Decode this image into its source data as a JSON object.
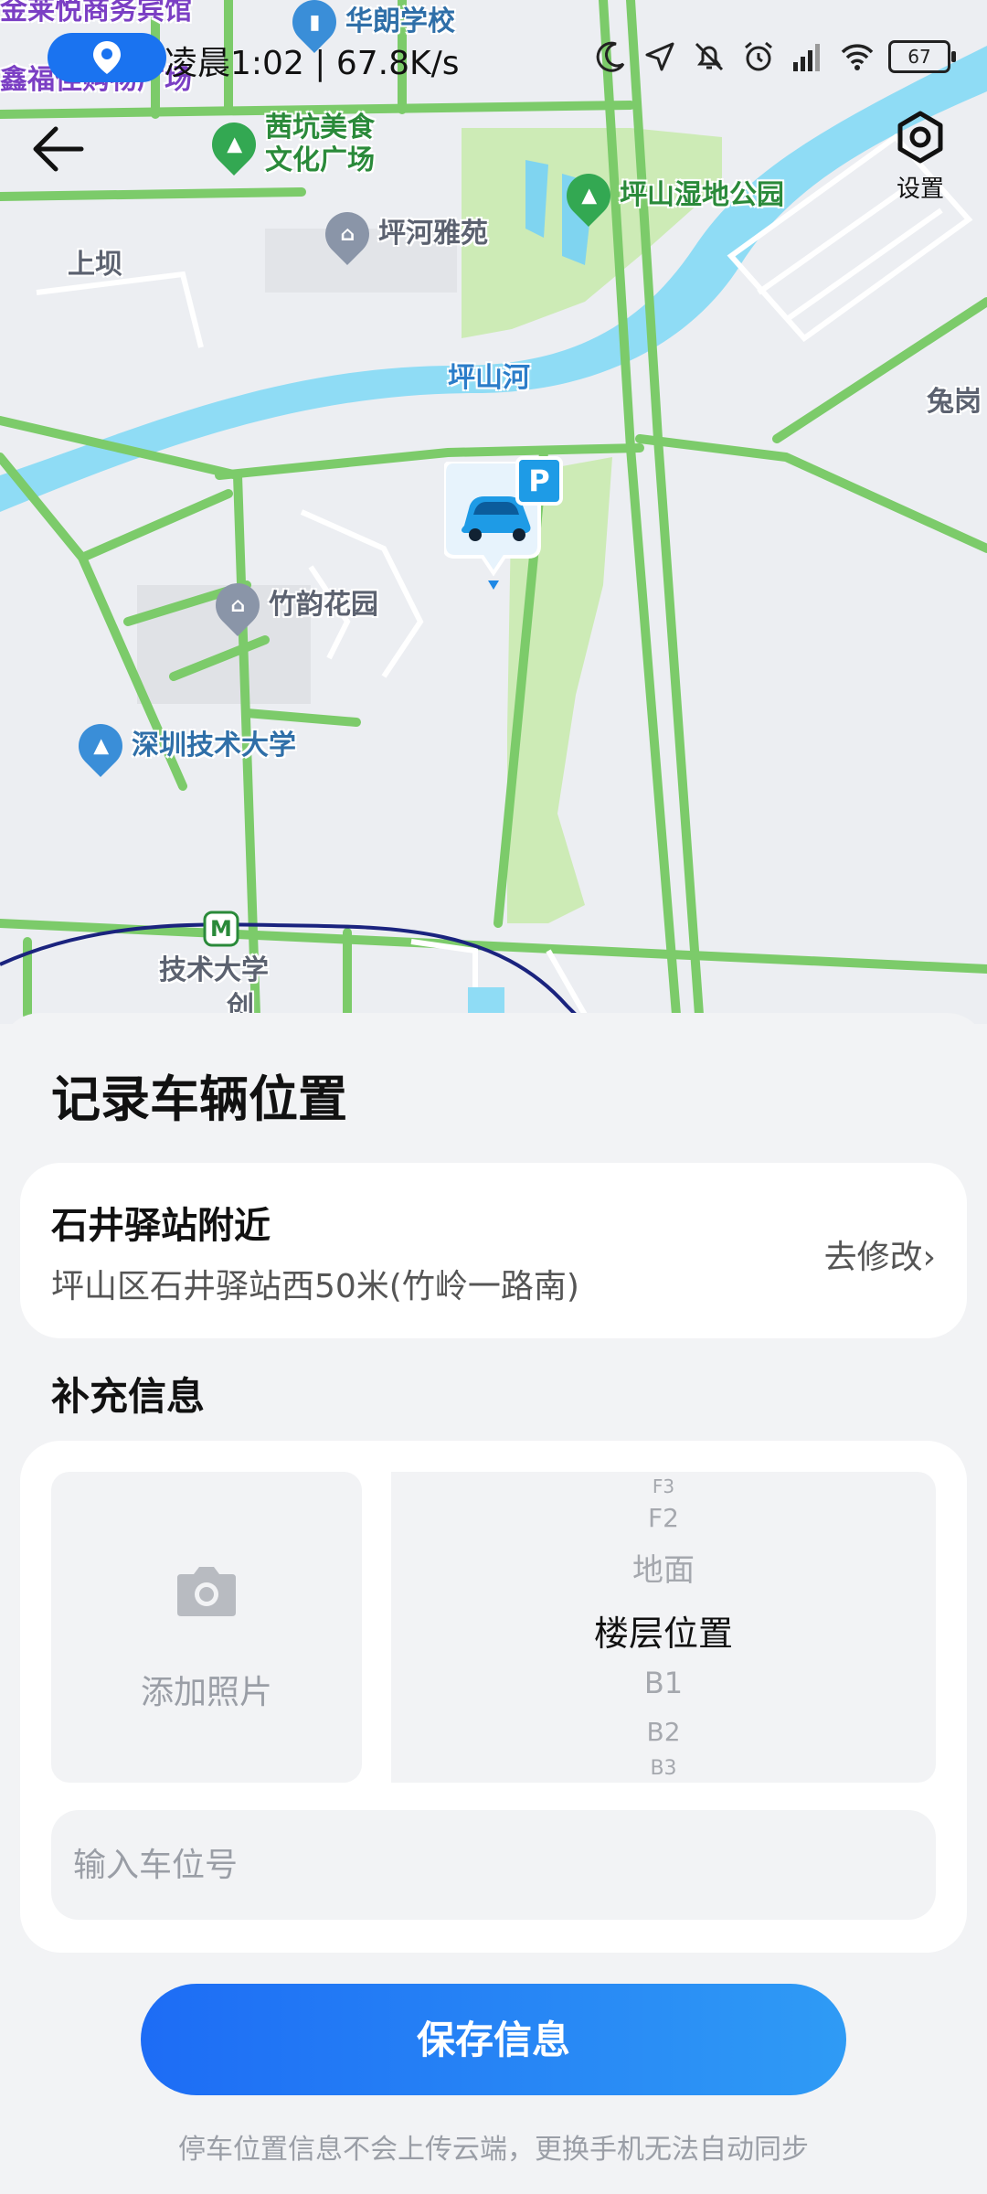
{
  "status_bar": {
    "time_speed": "凌晨1:02 | 67.8K/s",
    "battery": "67"
  },
  "map": {
    "settings_label": "设置",
    "labels": {
      "top_purple_1": "金莱悦商务宾馆",
      "top_purple_2": "鑫福佳购物广场",
      "school_top": "华朗学校",
      "food_plaza_1": "茜坑美食",
      "food_plaza_2": "文化广场",
      "wetland_park": "坪山湿地公园",
      "pinghe_yayuan": "坪河雅苑",
      "shangba": "上坝",
      "pingshan_river": "坪山河",
      "tugang": "兔岗",
      "zhuyun_garden": "竹韵花园",
      "tech_univ": "深圳技术大学",
      "metro_station": "技术大学",
      "metro_station_cut": "创"
    },
    "parking_badge": "P"
  },
  "sheet": {
    "title": "记录车辆位置",
    "location": {
      "name": "石井驿站附近",
      "address": "坪山区石井驿站西50米(竹岭一路南)",
      "edit_label": "去修改"
    },
    "section_label": "补充信息",
    "photo_label": "添加照片",
    "floors": [
      "F3",
      "F2",
      "地面",
      "楼层位置",
      "B1",
      "B2",
      "B3"
    ],
    "floor_selected": "楼层位置",
    "spot_input_placeholder": "输入车位号",
    "save_button": "保存信息",
    "footnote": "停车位置信息不会上传云端，更换手机无法自动同步"
  },
  "colors": {
    "accent": "#1d6cf5",
    "road_green": "#7ccb6a",
    "river": "#8fdcf5",
    "park": "#cdebb6",
    "metro_line": "#1a237e"
  }
}
